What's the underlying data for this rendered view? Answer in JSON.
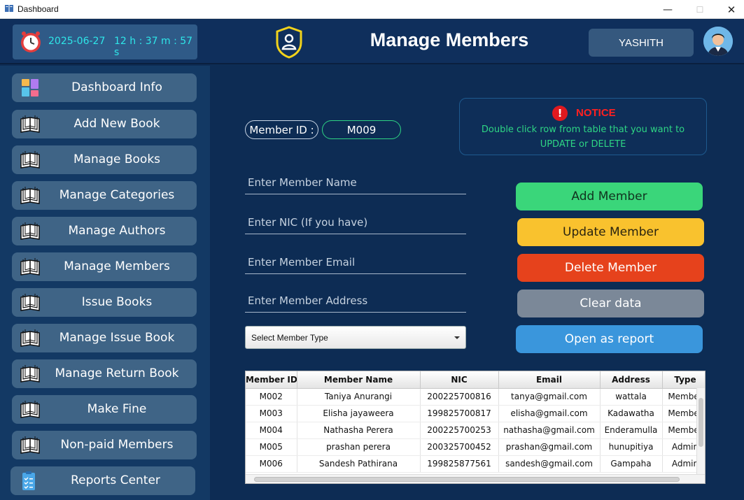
{
  "window": {
    "title": "Dashboard",
    "minimize": "—",
    "maximize": "☐",
    "close": "✕"
  },
  "header": {
    "date": "2025-06-27",
    "time": "12 h : 37 m : 57 s",
    "title": "Manage Members",
    "user": "YASHITH"
  },
  "sidebar": {
    "items": [
      {
        "label": "Dashboard Info",
        "icon": "dashboard-tiles-icon"
      },
      {
        "label": "Add New Book",
        "icon": "book-icon"
      },
      {
        "label": "Manage Books",
        "icon": "book-icon"
      },
      {
        "label": "Manage Categories",
        "icon": "book-icon"
      },
      {
        "label": "Manage Authors",
        "icon": "book-icon"
      },
      {
        "label": "Manage Members",
        "icon": "book-icon"
      },
      {
        "label": "Issue Books",
        "icon": "book-icon"
      },
      {
        "label": "Manage Issue Book",
        "icon": "book-icon"
      },
      {
        "label": "Manage Return Book",
        "icon": "book-icon"
      },
      {
        "label": "Make Fine",
        "icon": "book-icon"
      },
      {
        "label": "Non-paid Members",
        "icon": "book-icon"
      },
      {
        "label": "Reports Center",
        "icon": "clipboard-icon"
      }
    ]
  },
  "form": {
    "member_id_label": "Member ID :",
    "member_id_value": "M009",
    "name_placeholder": "Enter Member Name",
    "nic_placeholder": "Enter NIC (If you have)",
    "email_placeholder": "Enter Member Email",
    "address_placeholder": "Enter Member Address",
    "member_type": "Select Member Type"
  },
  "notice": {
    "title": "NOTICE",
    "line1": "Double click row from table that you want to",
    "line2": "UPDATE  or DELETE"
  },
  "actions": {
    "add": "Add Member",
    "update": "Update Member",
    "delete": "Delete Member",
    "clear": "Clear data",
    "report": "Open as report"
  },
  "colors": {
    "add": "#3ad67a",
    "update": "#f9c22e",
    "delete": "#e6421c",
    "clear": "#7b8898",
    "report": "#3a96dc"
  },
  "table": {
    "columns": [
      "Member ID",
      "Member Name",
      "NIC",
      "Email",
      "Address",
      "Type"
    ],
    "rows": [
      [
        "M002",
        "Taniya Anurangi",
        "200225700816",
        "tanya@gmail.com",
        "wattala",
        "Member"
      ],
      [
        "M003",
        "Elisha jayaweera",
        "199825700817",
        "elisha@gmail.com",
        "Kadawatha",
        "Member"
      ],
      [
        "M004",
        "Nathasha Perera",
        "200225700253",
        "nathasha@gmail.com",
        "Enderamulla",
        "Member"
      ],
      [
        "M005",
        "prashan perera",
        "200325700452",
        "prashan@gmail.com",
        "hunupitiya",
        "Admin"
      ],
      [
        "M006",
        "Sandesh Pathirana",
        "199825877561",
        "sandesh@gmail.com",
        "Gampaha",
        "Admin"
      ]
    ]
  }
}
